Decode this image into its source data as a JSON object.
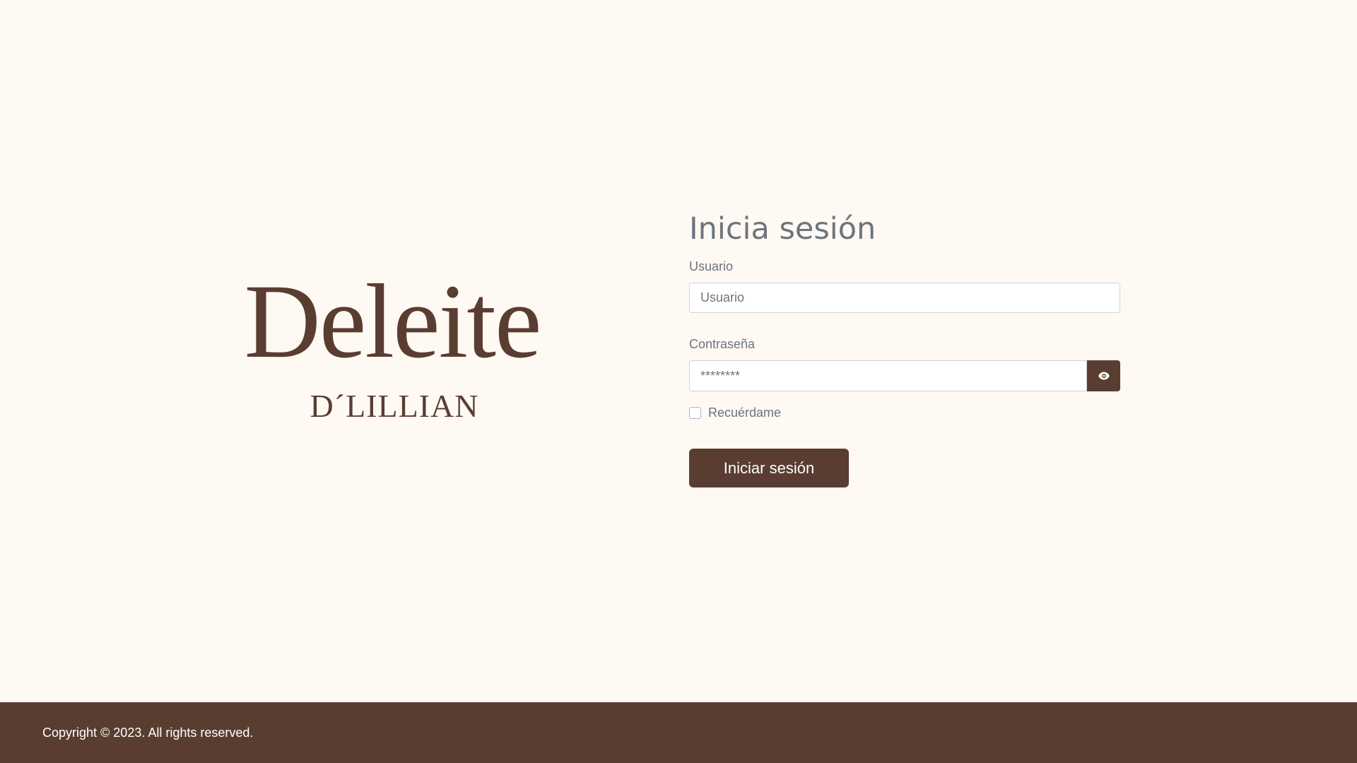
{
  "brand": {
    "wordmark": "Deleite",
    "subtitle": "D´LILLIAN"
  },
  "login": {
    "title": "Inicia sesión",
    "username": {
      "label": "Usuario",
      "placeholder": "Usuario",
      "value": ""
    },
    "password": {
      "label": "Contraseña",
      "value": "********",
      "toggle_icon": "eye-icon"
    },
    "remember": {
      "label": "Recuérdame",
      "checked": false
    },
    "submit_label": "Iniciar sesión"
  },
  "footer": {
    "copyright": "Copyright © 2023. All rights reserved."
  },
  "colors": {
    "background": "#fff9f3",
    "brand_brown": "#5a3d31",
    "muted_text": "#6c757d"
  }
}
